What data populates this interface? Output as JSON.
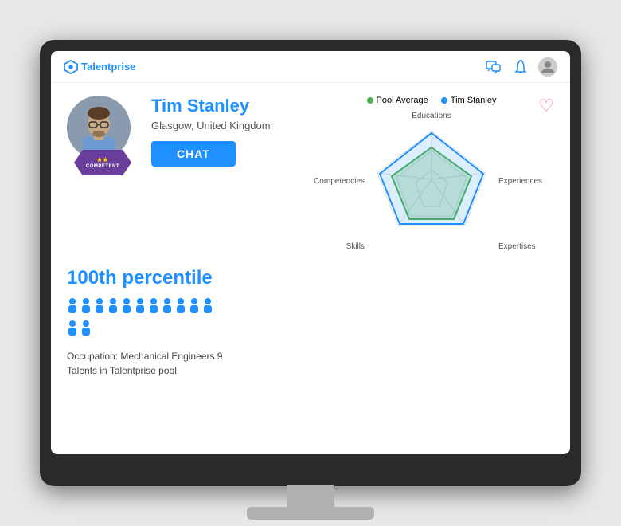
{
  "app": {
    "name": "Talent",
    "name_accent": "prise"
  },
  "nav": {
    "chat_icon": "💬",
    "bell_icon": "🔔",
    "avatar_icon": "👤"
  },
  "profile": {
    "name": "Tim Stanley",
    "location": "Glasgow, United Kingdom",
    "badge_label": "COMPETENT",
    "badge_stars": "★★",
    "chat_button": "CHAT",
    "heart_icon": "♡",
    "percentile": "100th percentile",
    "occupation": "Occupation: Mechanical Engineers 9 Talents in Talentprise pool"
  },
  "chart": {
    "legend": [
      {
        "label": "Pool Average",
        "color": "#4caf50"
      },
      {
        "label": "Tim Stanley",
        "color": "#1e90ff"
      }
    ],
    "labels": {
      "top": "Educations",
      "top_left": "Competencies",
      "top_right": "Experiences",
      "bottom_left": "Skills",
      "bottom_right": "Expertises"
    }
  },
  "people": {
    "count": 13,
    "icon": "👤"
  }
}
